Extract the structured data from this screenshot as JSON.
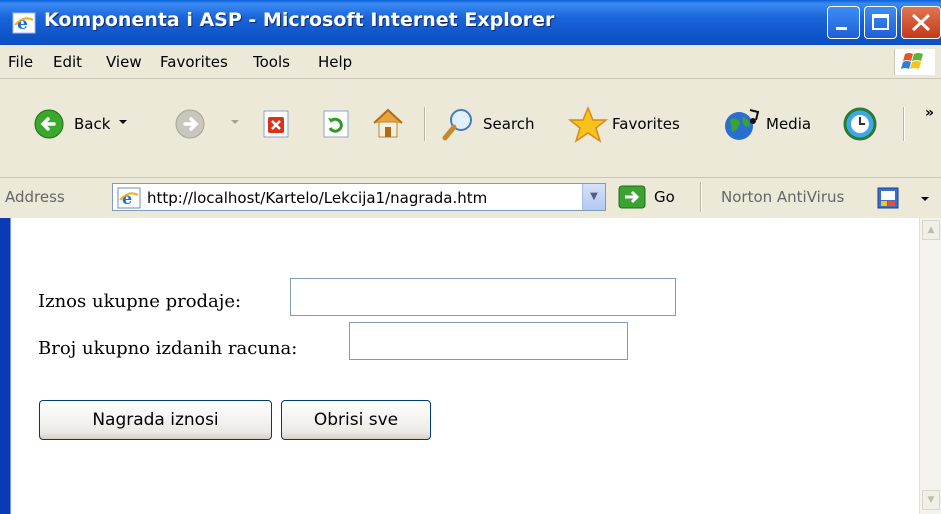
{
  "window": {
    "title": "Komponenta i ASP - Microsoft Internet Explorer"
  },
  "menu": {
    "items": [
      {
        "label": "File"
      },
      {
        "label": "Edit"
      },
      {
        "label": "View"
      },
      {
        "label": "Favorites"
      },
      {
        "label": "Tools"
      },
      {
        "label": "Help"
      }
    ]
  },
  "toolbar": {
    "back_label": "Back",
    "search_label": "Search",
    "favorites_label": "Favorites",
    "media_label": "Media",
    "more_glyph": "»"
  },
  "address": {
    "label": "Address",
    "url": "http://localhost/Kartelo/Lekcija1/nagrada.htm",
    "go_label": "Go",
    "norton_label": "Norton AntiVirus"
  },
  "form": {
    "sales_label": "Iznos ukupne prodaje:",
    "sales_value": "",
    "invoices_label": "Broj ukupno izdanih racuna:",
    "invoices_value": "",
    "reward_button": "Nagrada iznosi",
    "clear_button": "Obrisi sve"
  },
  "colors": {
    "titlebar": "#0f55c8",
    "chrome": "#ece9d8",
    "field_border": "#7f9db9",
    "button_border": "#003c74"
  }
}
